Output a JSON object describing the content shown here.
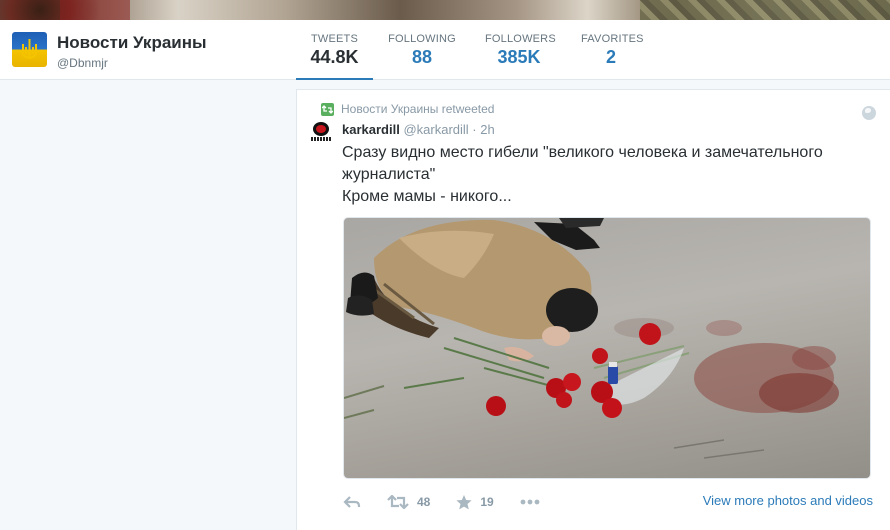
{
  "profile": {
    "name": "Новости Украины",
    "handle": "@Dbnmjr"
  },
  "stats": [
    {
      "label": "TWEETS",
      "value": "44.8K"
    },
    {
      "label": "FOLLOWING",
      "value": "88"
    },
    {
      "label": "FOLLOWERS",
      "value": "385K"
    },
    {
      "label": "FAVORITES",
      "value": "2"
    }
  ],
  "tweet": {
    "context": "Новости Украины retweeted",
    "author": "karkardill",
    "handle": "@karkardill",
    "separator": "·",
    "time": "2h",
    "text_line1": "Сразу видно место гибели \"великого человека и замечательного журналиста\"",
    "text_line2": "Кроме мамы - никого...",
    "retweets": "48",
    "favorites": "19",
    "view_more": "View more photos and videos"
  },
  "colors": {
    "link": "#2b7bb9",
    "retweet_green": "#5aaf5f"
  },
  "icons": [
    "reply-icon",
    "retweet-icon",
    "star-icon",
    "more-icon",
    "globe-icon"
  ]
}
